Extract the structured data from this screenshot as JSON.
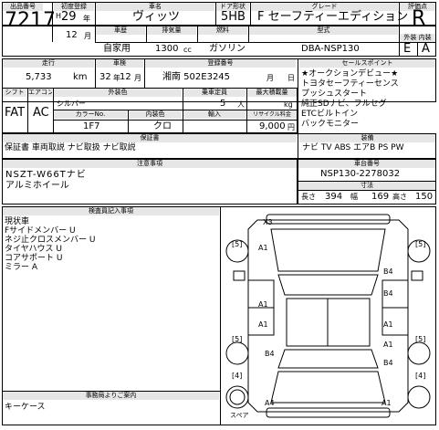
{
  "headers": {
    "lot_no": "出品番号",
    "first_reg": "初度登録",
    "model_name": "車名",
    "door_shape": "ドア形状",
    "grade": "グレード",
    "score": "評価点",
    "year_label": "年式",
    "purpose": "車歴",
    "displacement": "排気量",
    "fuel": "燃料",
    "model_code": "型式",
    "exterior_interior": "外装 内装",
    "mileage": "走行",
    "inspection": "車検",
    "reg_no": "登録番号",
    "sales_points": "セールスポイント",
    "shift": "シフト",
    "aircon": "エアコン",
    "ext_color": "外装色",
    "seats": "乗車定員",
    "max_load": "最大積載量",
    "color_no": "カラーNo.",
    "int_color": "内装色",
    "import": "輸入",
    "recycle": "リサイクル料金",
    "warranty": "保証書",
    "equipment": "装備",
    "notes": "注意事項",
    "chassis_no": "車台番号",
    "dimensions": "寸法",
    "inspector": "検査員記入事項",
    "office": "事務局よりご案内"
  },
  "lot_no": "7217",
  "era": "H",
  "year": "29",
  "month": "12",
  "month_unit": "月",
  "year_unit": "年",
  "model_name": "ヴィッツ",
  "door_shape": "5HB",
  "grade": "F セーフティーエディション",
  "score": "R",
  "purpose": "自家用",
  "displacement": "1300",
  "cc": "cc",
  "fuel": "ガソリン",
  "model_code": "DBA-NSP130",
  "exterior_grade": "E",
  "interior_grade": "A",
  "mileage": "5,733",
  "mileage_unit": "km",
  "inspection_year": "32",
  "inspection_month": "12",
  "reg_no": "湘南 502E3245",
  "sales_points": [
    "★オークションデビュー★",
    "トヨタセーフティーセンス",
    "プッシュスタート",
    "純正SDナビ、フルセグ",
    "ETCビルトイン",
    "バックモニター"
  ],
  "shift": "FAT",
  "aircon": "AC",
  "ext_color": "シルバー",
  "seats": "5",
  "seats_unit": "人",
  "max_load": "kg",
  "color_no": "1F7",
  "int_color": "クロ",
  "import": "",
  "recycle": "9,000",
  "yen": "円",
  "warranty": "保証書 車両取説 ナビ取扱 ナビ取説",
  "equipment": "ナビ TV ABS エアB PS PW",
  "notes_lines": [
    "NSZT-W66Tナビ",
    "アルミホイール"
  ],
  "chassis_no": "NSP130-2278032",
  "length_label": "長さ",
  "length": "394",
  "width_label": "幅",
  "width": "169",
  "height_label": "高さ",
  "height": "150",
  "inspector_lines": [
    "現状車",
    "Fサイドメンバー U",
    "ネジ止クロスメンバー U",
    "タイヤハウス U",
    "コアサポート U",
    "ミラー A"
  ],
  "office_lines": [
    "キーケース"
  ],
  "diagram_marks": [
    "X3",
    "A1",
    "B4",
    "A1",
    "B4",
    "A1",
    "A1",
    "B4",
    "A1",
    "B4",
    "A4",
    "A1"
  ],
  "tire_marks": [
    "5",
    "5",
    "5",
    "5",
    "4",
    "4"
  ],
  "spare_label": "スペア"
}
